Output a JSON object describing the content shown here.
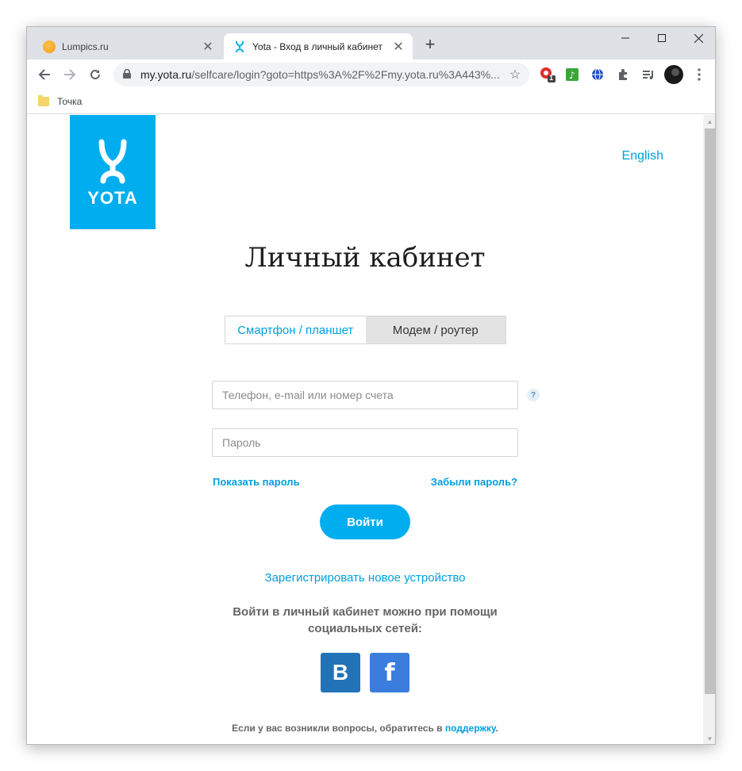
{
  "browser": {
    "tabs": [
      {
        "title": "Lumpics.ru",
        "favicon": "lumpics-favicon",
        "active": false
      },
      {
        "title": "Yota - Вход в личный кабинет",
        "favicon": "yota-favicon",
        "active": true
      }
    ],
    "address": {
      "host": "my.yota.ru",
      "path": "/selfcare/login?goto=https%3A%2F%2Fmy.yota.ru%3A443%..."
    },
    "bookmarks": [
      {
        "label": "Точка",
        "icon": "folder-icon"
      }
    ],
    "extension_badge": "1"
  },
  "page": {
    "logo_text": "YOTA",
    "language_link": "English",
    "title": "Личный кабинет",
    "device_tabs": [
      {
        "label": "Смартфон / планшет",
        "selected": true
      },
      {
        "label": "Модем / роутер",
        "selected": false
      }
    ],
    "login_placeholder": "Телефон, e-mail или номер счета",
    "password_placeholder": "Пароль",
    "help_symbol": "?",
    "show_password": "Показать пароль",
    "forgot_password": "Забыли пароль?",
    "login_button": "Войти",
    "register_link": "Зарегистрировать новое устройство",
    "social_text": "Войти в личный кабинет можно при помощи социальных сетей:",
    "social": [
      {
        "label": "В",
        "network": "vkontakte",
        "color": "#2272b8"
      },
      {
        "label": "f",
        "network": "facebook",
        "color": "#3b7ddd"
      }
    ],
    "footer_text": "Если у вас возникли вопросы, обратитесь в ",
    "footer_link": "поддержку",
    "footer_end": "."
  },
  "colors": {
    "accent": "#00aeef",
    "link": "#00a0df"
  }
}
